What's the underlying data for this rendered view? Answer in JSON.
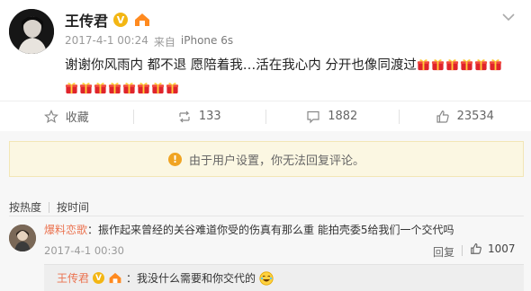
{
  "post": {
    "author": "王传君",
    "timestamp": "2017-4-1 00:24",
    "source_prefix": "来自",
    "source": "iPhone 6s",
    "text": "谢谢你风雨内 都不退 愿陪着我…活在我心内 分开也像同渡过",
    "gift_icon": "red-gift-emoji",
    "gift_count_line1": 6,
    "gift_count_line2": 8
  },
  "actions": {
    "favorite_label": "收藏",
    "repost_count": "133",
    "comment_count": "1882",
    "like_count": "23534"
  },
  "notice": {
    "text": "由于用户设置，你无法回复评论。"
  },
  "sort": {
    "hot_label": "按热度",
    "time_label": "按时间"
  },
  "comment": {
    "user": "爆料恋歌",
    "text": "：振作起来曾经的关谷难道你受的伤真有那么重 能拍壳委5给我们一个交代吗",
    "timestamp": "2017-4-1 00:30",
    "reply_label": "回复",
    "like_count": "1007"
  },
  "reply": {
    "user": "王传君",
    "text": "：我没什么需要和你交代的",
    "emoji": "laughing-emoji"
  },
  "colors": {
    "username": "#eb7350",
    "verified_badge": "#f3b613",
    "notice_bg": "#fbf7e2"
  }
}
